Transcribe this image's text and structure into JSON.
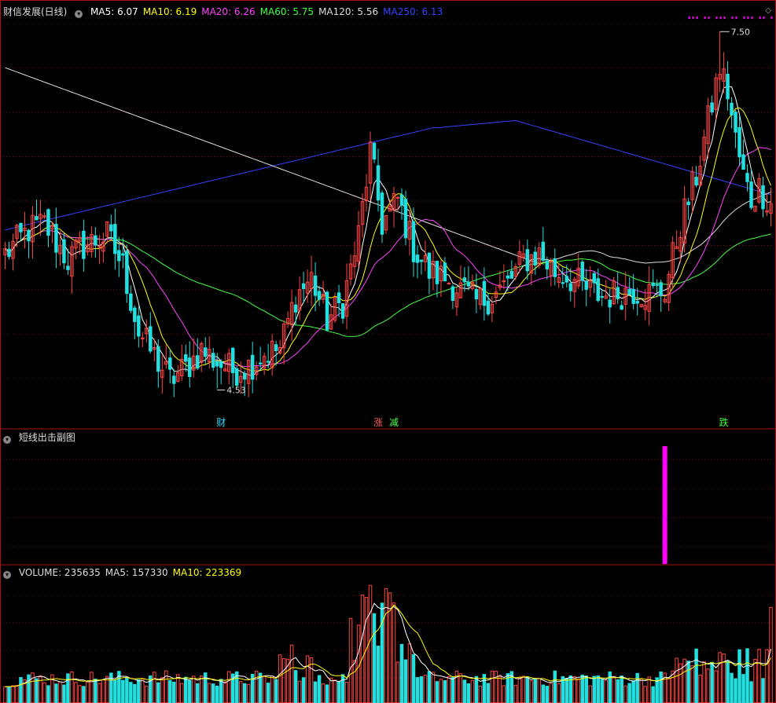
{
  "main_panel": {
    "title": "财信发展(日线)",
    "indicators": [
      {
        "label": "MA5:",
        "value": "6.07",
        "color": "#ffffff"
      },
      {
        "label": "MA10:",
        "value": "6.19",
        "color": "#ffff00"
      },
      {
        "label": "MA20:",
        "value": "6.26",
        "color": "#ff44ff"
      },
      {
        "label": "MA60:",
        "value": "5.75",
        "color": "#44ff44"
      },
      {
        "label": "MA120:",
        "value": "5.56",
        "color": "#dddddd"
      },
      {
        "label": "MA250:",
        "value": "6.13",
        "color": "#3344ff"
      }
    ],
    "high_label": "7.50",
    "low_label": "4.53",
    "signals": [
      {
        "text": "财",
        "color": "#33ddff",
        "index": 55
      },
      {
        "text": "涨",
        "color": "#ff5555",
        "index": 95
      },
      {
        "text": "减",
        "color": "#44ff44",
        "index": 99
      },
      {
        "text": "跌",
        "color": "#44ff44",
        "index": 183
      }
    ]
  },
  "sub_panel": {
    "title": "短线出击副图",
    "bar_index": 168,
    "bar_color": "#ff00ff"
  },
  "volume_panel": {
    "labels": [
      {
        "label": "VOLUME:",
        "value": "235635",
        "color": "#dddddd"
      },
      {
        "label": "MA5:",
        "value": "157330",
        "color": "#dddddd"
      },
      {
        "label": "MA10:",
        "value": "223369",
        "color": "#ffff00"
      }
    ]
  },
  "colors": {
    "up": "#ff4444",
    "down": "#22e0e0",
    "grid": "#7a1010",
    "ma5": "#ffffff",
    "ma10": "#ffff00",
    "ma20": "#ff44ff",
    "ma60": "#44ff44",
    "ma120": "#dddddd",
    "ma250": "#3344ff"
  },
  "chart_data": {
    "type": "candlestick",
    "ylim": [
      4.2,
      7.6
    ],
    "bars": 196,
    "anchors_close": [
      [
        0,
        5.65
      ],
      [
        6,
        5.85
      ],
      [
        10,
        5.9
      ],
      [
        16,
        5.6
      ],
      [
        20,
        5.72
      ],
      [
        26,
        5.8
      ],
      [
        30,
        5.55
      ],
      [
        34,
        5.0
      ],
      [
        38,
        4.8
      ],
      [
        42,
        4.6
      ],
      [
        46,
        4.7
      ],
      [
        50,
        4.85
      ],
      [
        54,
        4.75
      ],
      [
        58,
        4.68
      ],
      [
        62,
        4.72
      ],
      [
        66,
        4.82
      ],
      [
        70,
        4.86
      ],
      [
        74,
        5.3
      ],
      [
        78,
        5.45
      ],
      [
        82,
        5.1
      ],
      [
        86,
        5.25
      ],
      [
        90,
        5.8
      ],
      [
        93,
        6.5
      ],
      [
        96,
        5.9
      ],
      [
        100,
        6.1
      ],
      [
        104,
        5.7
      ],
      [
        108,
        5.5
      ],
      [
        112,
        5.45
      ],
      [
        116,
        5.35
      ],
      [
        120,
        5.25
      ],
      [
        124,
        5.3
      ],
      [
        128,
        5.4
      ],
      [
        132,
        5.6
      ],
      [
        136,
        5.65
      ],
      [
        140,
        5.5
      ],
      [
        144,
        5.45
      ],
      [
        148,
        5.35
      ],
      [
        152,
        5.3
      ],
      [
        156,
        5.32
      ],
      [
        160,
        5.35
      ],
      [
        164,
        5.32
      ],
      [
        168,
        5.35
      ],
      [
        172,
        5.9
      ],
      [
        176,
        6.3
      ],
      [
        178,
        6.6
      ],
      [
        180,
        6.9
      ],
      [
        182,
        7.2
      ],
      [
        184,
        7.0
      ],
      [
        186,
        6.6
      ],
      [
        188,
        6.3
      ],
      [
        190,
        6.1
      ],
      [
        192,
        6.2
      ],
      [
        195,
        6.07
      ]
    ],
    "volume_ylim": [
      0,
      300000
    ]
  }
}
